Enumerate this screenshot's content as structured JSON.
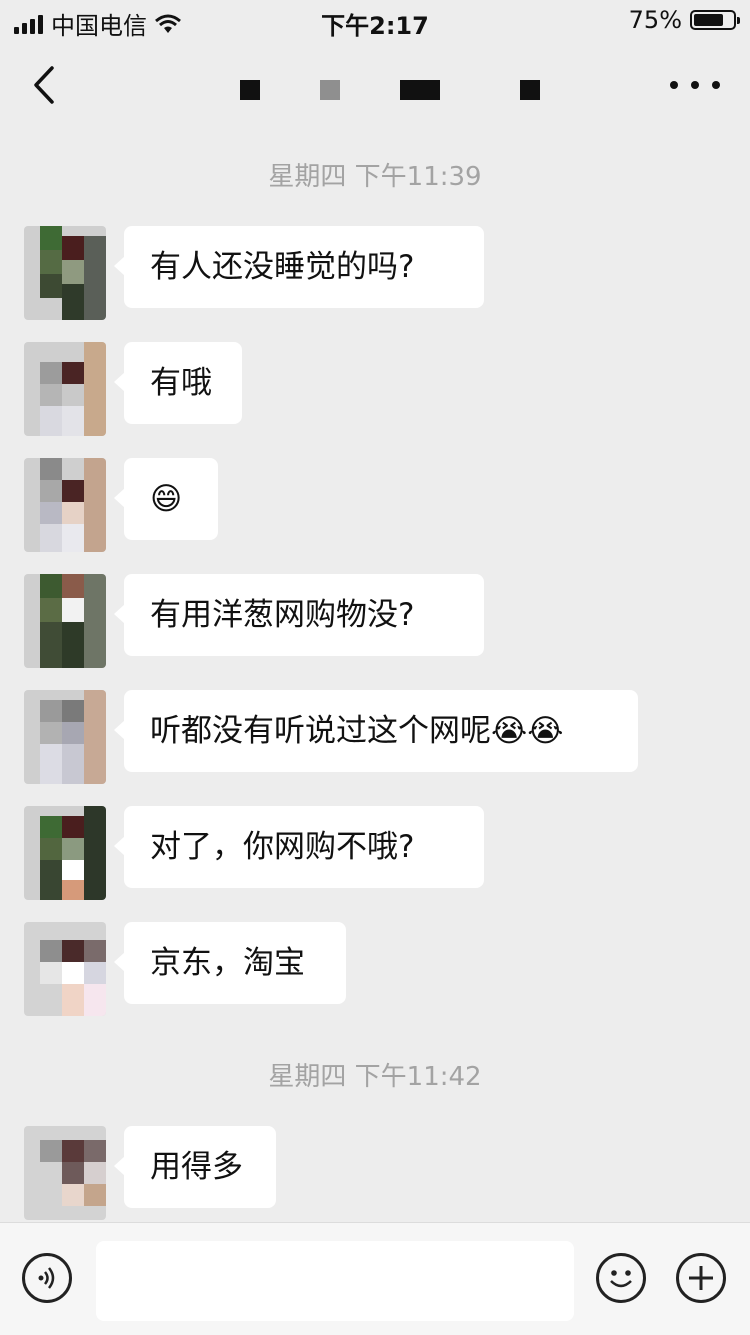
{
  "status_bar": {
    "carrier": "中国电信",
    "time": "下午2:17",
    "battery_percent": "75%",
    "battery_level": 0.75,
    "icons": [
      "signal-icon",
      "wifi-icon",
      "battery-icon"
    ]
  },
  "nav": {
    "back_icon": "chevron-left-icon",
    "title": "",
    "more_icon": "more-dots-icon"
  },
  "chat": {
    "timestamps": [
      "星期四 下午11:39",
      "星期四 下午11:42"
    ],
    "messages": [
      {
        "text": "有人还没睡觉的吗?"
      },
      {
        "text": "有哦"
      },
      {
        "text": "😄"
      },
      {
        "text": "有用洋葱网购物没?"
      },
      {
        "text": "听都没有听说过这个网呢😭😭"
      },
      {
        "text": "对了，你网购不哦?"
      },
      {
        "text": "京东，淘宝"
      },
      {
        "text": "用得多"
      }
    ]
  },
  "input_bar": {
    "voice_icon": "voice-icon",
    "text_value": "",
    "emoji_icon": "emoji-icon",
    "plus_icon": "plus-icon"
  },
  "colors": {
    "background": "#ededed",
    "bubble": "#ffffff",
    "timestamp_text": "#a3a3a3"
  }
}
